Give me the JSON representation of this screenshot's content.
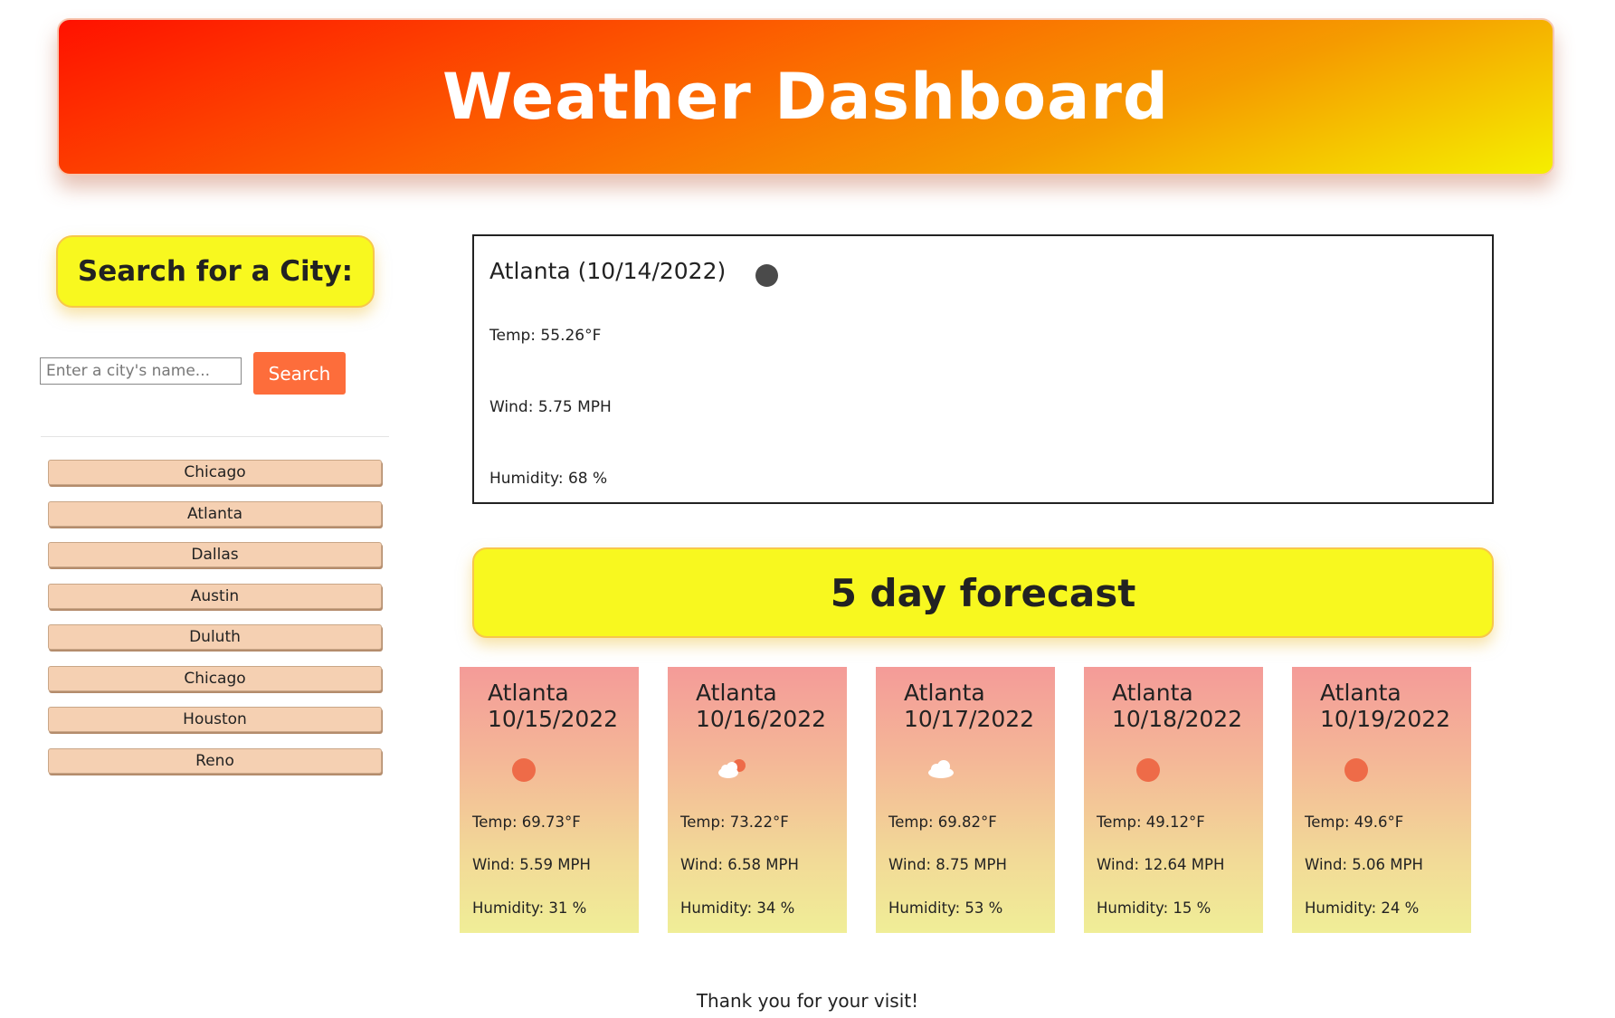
{
  "header": {
    "title": "Weather Dashboard"
  },
  "sidebar": {
    "heading": "Search for a City:",
    "search": {
      "placeholder": "Enter a city's name...",
      "value": "",
      "button_label": "Search"
    },
    "history": [
      "Chicago",
      "Atlanta",
      "Dallas",
      "Austin",
      "Duluth",
      "Chicago",
      "Houston",
      "Reno"
    ]
  },
  "current": {
    "title": "Atlanta (10/14/2022)",
    "icon": "moon-icon",
    "temp": "Temp: 55.26°F",
    "wind": "Wind: 5.75 MPH",
    "humidity": "Humidity: 68 %"
  },
  "forecast": {
    "heading": "5 day forecast",
    "days": [
      {
        "city": "Atlanta",
        "date": "10/15/2022",
        "icon": "sun-icon",
        "temp": "Temp: 69.73°F",
        "wind": "Wind: 5.59 MPH",
        "humidity": "Humidity: 31 %"
      },
      {
        "city": "Atlanta",
        "date": "10/16/2022",
        "icon": "cloud-sun-icon",
        "temp": "Temp: 73.22°F",
        "wind": "Wind: 6.58 MPH",
        "humidity": "Humidity: 34 %"
      },
      {
        "city": "Atlanta",
        "date": "10/17/2022",
        "icon": "cloud-icon",
        "temp": "Temp: 69.82°F",
        "wind": "Wind: 8.75 MPH",
        "humidity": "Humidity: 53 %"
      },
      {
        "city": "Atlanta",
        "date": "10/18/2022",
        "icon": "sun-icon",
        "temp": "Temp: 49.12°F",
        "wind": "Wind: 12.64 MPH",
        "humidity": "Humidity: 15 %"
      },
      {
        "city": "Atlanta",
        "date": "10/19/2022",
        "icon": "sun-icon",
        "temp": "Temp: 49.6°F",
        "wind": "Wind: 5.06 MPH",
        "humidity": "Humidity: 24 %"
      }
    ]
  },
  "footer": {
    "text": "Thank you for your visit!"
  },
  "colors": {
    "header_gradient": [
      "#ff1100",
      "#f5ef00"
    ],
    "highlight_yellow": "#f8f81f",
    "search_button": "#fd6d3b",
    "history_button": "#f5d0b2",
    "sun": "#ee6b48"
  }
}
